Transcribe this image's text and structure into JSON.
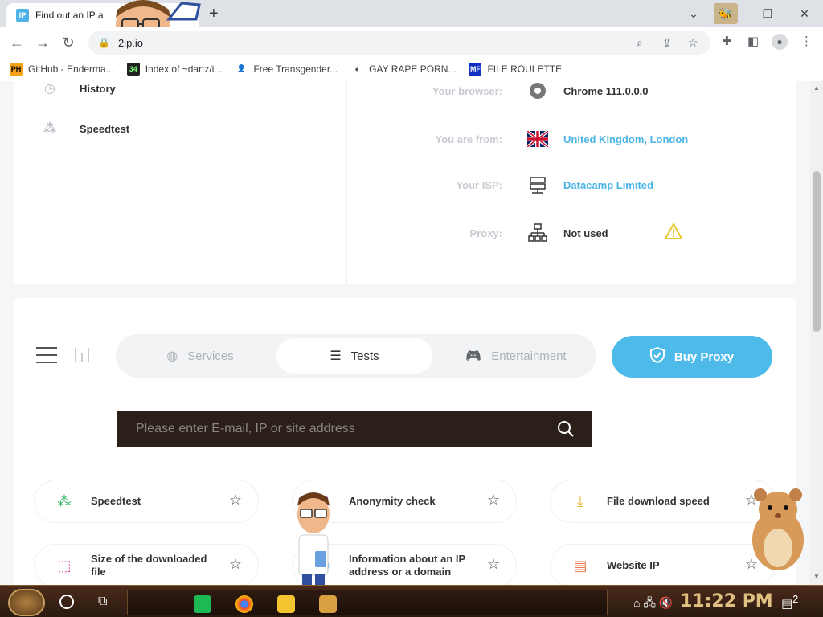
{
  "browser": {
    "tab_title": "Find out an IP a",
    "favicon_text": "IP",
    "url": "2ip.io",
    "new_tab": "+",
    "close_tab": "✕"
  },
  "bookmarks": [
    {
      "label": "GitHub - Enderma...",
      "icon_text": "PH",
      "icon_bg": "#f7a21b",
      "icon_color": "#000"
    },
    {
      "label": "Index of ~dartz/i...",
      "icon_text": "34",
      "icon_bg": "#222",
      "icon_color": "#7f7"
    },
    {
      "label": "Free Transgender...",
      "icon_text": "👤",
      "icon_bg": "#fff",
      "icon_color": "#333"
    },
    {
      "label": "GAY RAPE PORN...",
      "icon_text": "●",
      "icon_bg": "#fff",
      "icon_color": "#555"
    },
    {
      "label": "FILE ROULETTE",
      "icon_text": "MF",
      "icon_bg": "#1030c0",
      "icon_color": "#fff"
    }
  ],
  "sidebar": {
    "items": [
      {
        "label": "History",
        "icon": "history-icon"
      },
      {
        "label": "Speedtest",
        "icon": "speedtest-icon"
      }
    ]
  },
  "info": {
    "browser_label": "Your browser:",
    "browser_value": "Chrome 111.0.0.0",
    "location_label": "You are from:",
    "location_value": "United Kingdom, London",
    "isp_label": "Your ISP:",
    "isp_value": "Datacamp Limited",
    "proxy_label": "Proxy:",
    "proxy_value": "Not used"
  },
  "tabs": [
    {
      "label": "Services",
      "icon": "globe-icon"
    },
    {
      "label": "Tests",
      "icon": "sliders-icon",
      "active": true
    },
    {
      "label": "Entertainment",
      "icon": "gamepad-icon"
    }
  ],
  "buy_proxy_label": "Buy Proxy",
  "search": {
    "placeholder": "Please enter E-mail, IP or site address"
  },
  "tools": [
    {
      "label": "Speedtest",
      "icon": "speedtest-icon"
    },
    {
      "label": "Anonymity check",
      "icon": "anonymity-icon"
    },
    {
      "label": "File download speed",
      "icon": "download-icon"
    },
    {
      "label": "Size of the downloaded file",
      "icon": "file-size-icon"
    },
    {
      "label": "Information about an IP address or a domain",
      "icon": "ip-info-icon"
    },
    {
      "label": "Website IP",
      "icon": "website-icon"
    }
  ],
  "taskbar": {
    "clock": "11:22 PM",
    "notifications": "2"
  },
  "colors": {
    "accent": "#4dbaea",
    "link": "#4bb4e6",
    "search_bg": "#2b1f1a"
  }
}
